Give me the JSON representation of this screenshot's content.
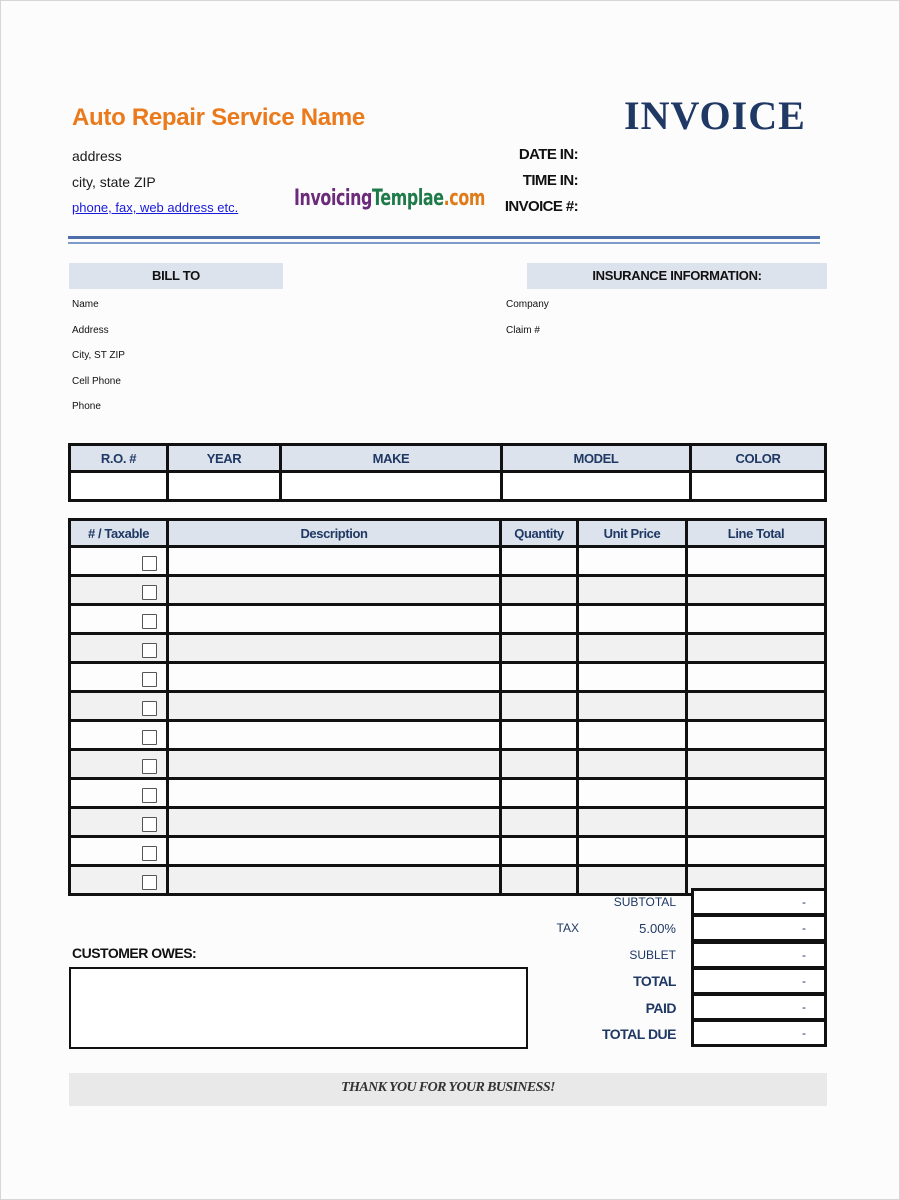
{
  "business": {
    "name": "Auto Repair Service Name",
    "address": "address",
    "city_state_zip": "city, state ZIP",
    "contact_link": "phone, fax, web address etc.",
    "brand_color": "#ea7a1b"
  },
  "logo": {
    "text_parts": [
      {
        "text": "Invoicing",
        "color": "#6b2a7a"
      },
      {
        "text": "Templae",
        "color": "#1f7a4a"
      },
      {
        "text": ".com",
        "color": "#e07b1a"
      }
    ]
  },
  "header": {
    "title": "INVOICE",
    "title_color": "#1f3864",
    "date_in_label": "DATE IN:",
    "time_in_label": "TIME IN:",
    "invoice_no_label": "INVOICE #:"
  },
  "bill_to": {
    "heading": "BILL TO",
    "fields": [
      "Name",
      "Address",
      "City, ST ZIP",
      "Cell Phone",
      "Phone"
    ]
  },
  "insurance": {
    "heading": "INSURANCE INFORMATION:",
    "fields": [
      "Company",
      "Claim #"
    ]
  },
  "vehicle_table": {
    "columns": [
      "R.O. #",
      "YEAR",
      "MAKE",
      "MODEL",
      "COLOR"
    ],
    "rows": [
      [
        "",
        "",
        "",
        "",
        ""
      ]
    ]
  },
  "items_table": {
    "columns": [
      "# / Taxable",
      "Description",
      "Quantity",
      "Unit Price",
      "Line Total"
    ],
    "row_count": 12,
    "rows": [
      {
        "taxable": false,
        "description": "",
        "quantity": "",
        "unit_price": "",
        "line_total": ""
      },
      {
        "taxable": false,
        "description": "",
        "quantity": "",
        "unit_price": "",
        "line_total": ""
      },
      {
        "taxable": false,
        "description": "",
        "quantity": "",
        "unit_price": "",
        "line_total": ""
      },
      {
        "taxable": false,
        "description": "",
        "quantity": "",
        "unit_price": "",
        "line_total": ""
      },
      {
        "taxable": false,
        "description": "",
        "quantity": "",
        "unit_price": "",
        "line_total": ""
      },
      {
        "taxable": false,
        "description": "",
        "quantity": "",
        "unit_price": "",
        "line_total": ""
      },
      {
        "taxable": false,
        "description": "",
        "quantity": "",
        "unit_price": "",
        "line_total": ""
      },
      {
        "taxable": false,
        "description": "",
        "quantity": "",
        "unit_price": "",
        "line_total": ""
      },
      {
        "taxable": false,
        "description": "",
        "quantity": "",
        "unit_price": "",
        "line_total": ""
      },
      {
        "taxable": false,
        "description": "",
        "quantity": "",
        "unit_price": "",
        "line_total": ""
      },
      {
        "taxable": false,
        "description": "",
        "quantity": "",
        "unit_price": "",
        "line_total": ""
      },
      {
        "taxable": false,
        "description": "",
        "quantity": "",
        "unit_price": "",
        "line_total": ""
      }
    ]
  },
  "totals": {
    "subtotal_label": "SUBTOTAL",
    "subtotal_value": "-",
    "tax_label": "TAX",
    "tax_rate": "5.00%",
    "tax_value": "-",
    "sublet_label": "SUBLET",
    "sublet_value": "-",
    "total_label": "TOTAL",
    "total_value": "-",
    "paid_label": "PAID",
    "paid_value": "-",
    "total_due_label": "TOTAL DUE",
    "total_due_value": "-"
  },
  "customer_owes": {
    "label": "CUSTOMER OWES:",
    "value": ""
  },
  "footer": {
    "thanks": "THANK YOU FOR YOUR BUSINESS!"
  }
}
